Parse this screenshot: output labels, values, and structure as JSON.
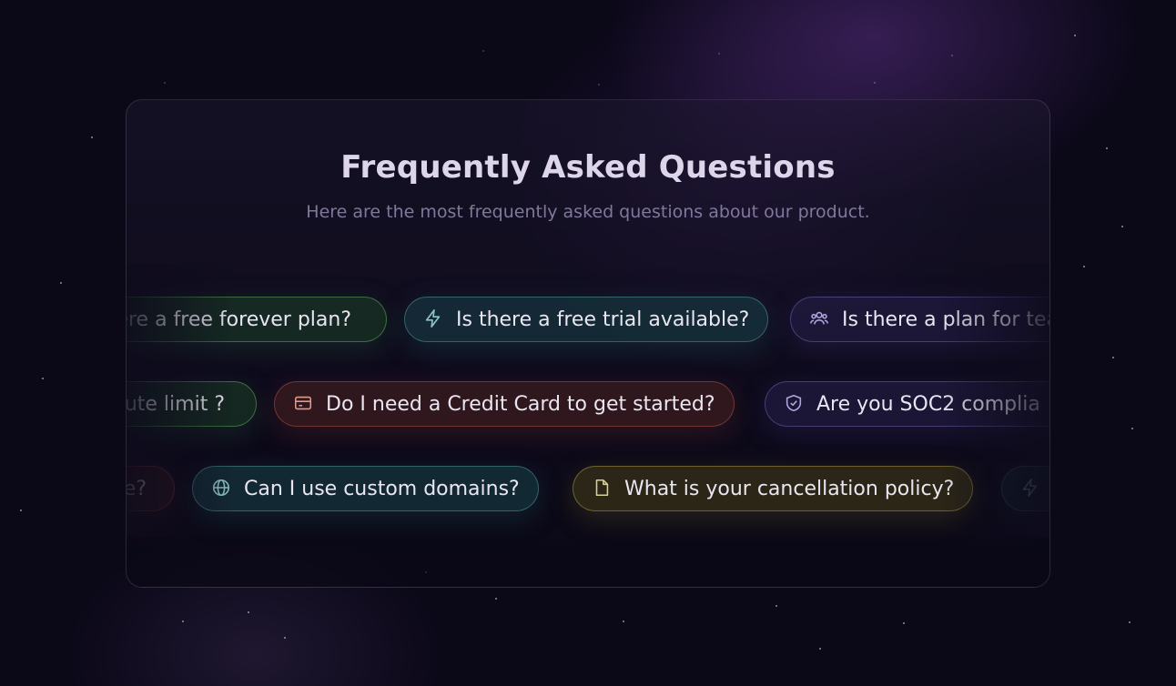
{
  "faq": {
    "title": "Frequently Asked Questions",
    "subtitle": "Here are the most frequently asked questions about our product.",
    "rows": [
      [
        {
          "label": "ere a free forever plan?",
          "icon": "none",
          "color": "green"
        },
        {
          "label": "Is there a free trial available?",
          "icon": "lightning-icon",
          "color": "teal"
        },
        {
          "label": "Is there a plan for tea",
          "icon": "users-icon",
          "color": "purple"
        }
      ],
      [
        {
          "label": "ute limit ?",
          "icon": "none",
          "color": "green"
        },
        {
          "label": "Do I need a Credit Card to get started?",
          "icon": "credit-card-icon",
          "color": "red"
        },
        {
          "label": "Are you SOC2 complia",
          "icon": "shield-check-icon",
          "color": "purple"
        }
      ],
      [
        {
          "label": "e?",
          "icon": "none",
          "color": "red"
        },
        {
          "label": "Can I use custom domains?",
          "icon": "globe-icon",
          "color": "teal"
        },
        {
          "label": "What is your cancellation policy?",
          "icon": "document-icon",
          "color": "olive"
        },
        {
          "label": "",
          "icon": "lightning-icon",
          "color": "teal"
        }
      ]
    ]
  },
  "colors": {
    "background": "#0b0818",
    "title": "#ddd6ea",
    "subtitle": "#7f789c",
    "pill_text": "#e9e6f2"
  }
}
